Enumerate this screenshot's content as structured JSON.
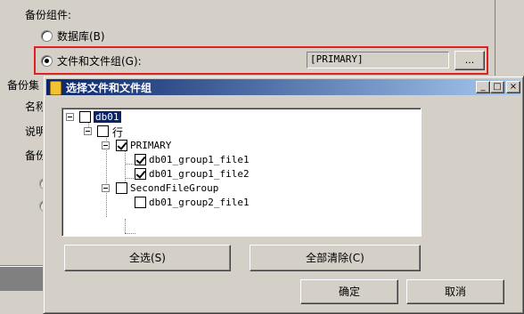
{
  "background": {
    "backup_component_label": "备份组件:",
    "radio_database": "数据库(B)",
    "radio_files": "文件和文件组(G):",
    "files_value": "[PRIMARY]",
    "browse_button": "...",
    "backup_set_label": "备份集",
    "name_label": "名称",
    "description_label": "说明",
    "expire_label": "备份"
  },
  "dialog": {
    "title": "选择文件和文件组",
    "minimize": "_",
    "maximize": "□",
    "close": "×",
    "tree": {
      "root": "db01",
      "rows_node": "行",
      "primary": "PRIMARY",
      "file1": "db01_group1_file1",
      "file2": "db01_group1_file2",
      "second_group": "SecondFileGroup",
      "file3": "db01_group2_file1"
    },
    "select_all": "全选(S)",
    "clear_all": "全部清除(C)",
    "ok": "确定",
    "cancel": "取消"
  }
}
